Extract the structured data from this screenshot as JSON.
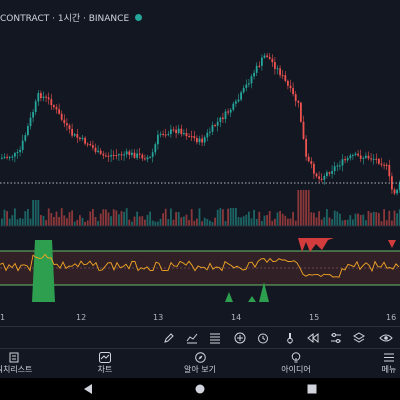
{
  "header": {
    "title": "CONTRACT · 1시간 · BINANCE"
  },
  "chart_data": {
    "type": "candlestick",
    "x_tick_labels": [
      "1",
      "12",
      "13",
      "14",
      "15",
      "16"
    ],
    "colors": {
      "up": "#26a69a",
      "down": "#ef5350",
      "indicator_line": "#f5a623",
      "band": "#66bb6a"
    }
  },
  "date_axis": {
    "labels": [
      "1",
      "12",
      "13",
      "14",
      "15",
      "16"
    ]
  },
  "toolbar": {
    "tools": [
      "pencil-icon",
      "pattern-icon",
      "scale-icon",
      "plus-circle-icon",
      "alarm-icon",
      "replay-icon",
      "rewind-icon",
      "settings-sliders-icon",
      "layers-icon",
      "eye-icon",
      "more-icon"
    ]
  },
  "bottom_nav": {
    "items": [
      {
        "icon": "watchlist-icon",
        "label": "워치리스트"
      },
      {
        "icon": "chart-icon",
        "label": "차트"
      },
      {
        "icon": "explore-icon",
        "label": "알아 보기"
      },
      {
        "icon": "ideas-icon",
        "label": "아이디어"
      },
      {
        "icon": "menu-icon",
        "label": "메뉴"
      }
    ]
  }
}
